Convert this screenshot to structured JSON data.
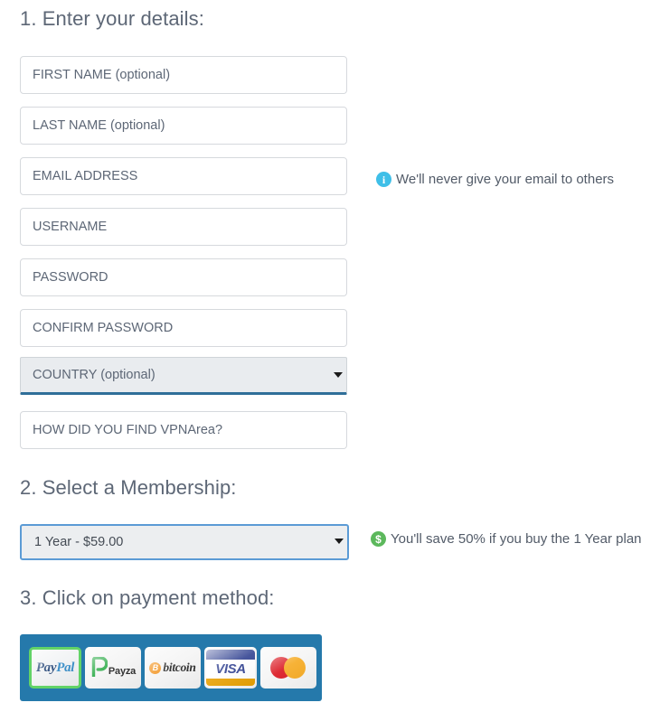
{
  "sections": {
    "details_heading": "1. Enter your details:",
    "membership_heading": "2. Select a Membership:",
    "payment_heading": "3. Click on payment method:"
  },
  "form": {
    "fields": [
      {
        "name": "first-name",
        "placeholder": "FIRST NAME (optional)",
        "value": ""
      },
      {
        "name": "last-name",
        "placeholder": "LAST NAME (optional)",
        "value": ""
      },
      {
        "name": "email",
        "placeholder": "EMAIL ADDRESS",
        "value": ""
      },
      {
        "name": "username",
        "placeholder": "USERNAME",
        "value": ""
      },
      {
        "name": "password",
        "placeholder": "PASSWORD",
        "value": ""
      },
      {
        "name": "confirm-password",
        "placeholder": "CONFIRM PASSWORD",
        "value": ""
      },
      {
        "name": "referral",
        "placeholder": "HOW DID YOU FIND VPNArea?",
        "value": ""
      }
    ],
    "country_select": {
      "selected": "COUNTRY (optional)",
      "arrow_icon": "chevron-down-icon"
    }
  },
  "membership": {
    "selected": "1 Year - $59.00",
    "arrow_icon": "chevron-down-icon"
  },
  "notes": {
    "email": {
      "icon": "info-icon",
      "text": "We'll never give your email to others"
    },
    "savings": {
      "icon": "dollar-icon",
      "text": "You'll save 50% if you buy the 1 Year plan"
    }
  },
  "payment_methods": [
    {
      "name": "paypal",
      "label": "PayPal",
      "label_a": "Pay",
      "label_b": "Pal",
      "selected": true
    },
    {
      "name": "payza",
      "label": "Payza",
      "selected": false
    },
    {
      "name": "bitcoin",
      "label": "bitcoin",
      "mark": "B",
      "selected": false
    },
    {
      "name": "visa",
      "label": "VISA",
      "selected": false
    },
    {
      "name": "mastercard",
      "label": "Mastercard",
      "selected": false
    }
  ],
  "colors": {
    "heading": "#5d6776",
    "field_border": "#d6d9dd",
    "country_underline": "#2f6f99",
    "membership_focus": "#5b9bd5",
    "payment_bar": "#2579ab",
    "selected_outline": "#62d367",
    "info_badge": "#3fbfe8",
    "dollar_badge": "#5cb85c"
  }
}
